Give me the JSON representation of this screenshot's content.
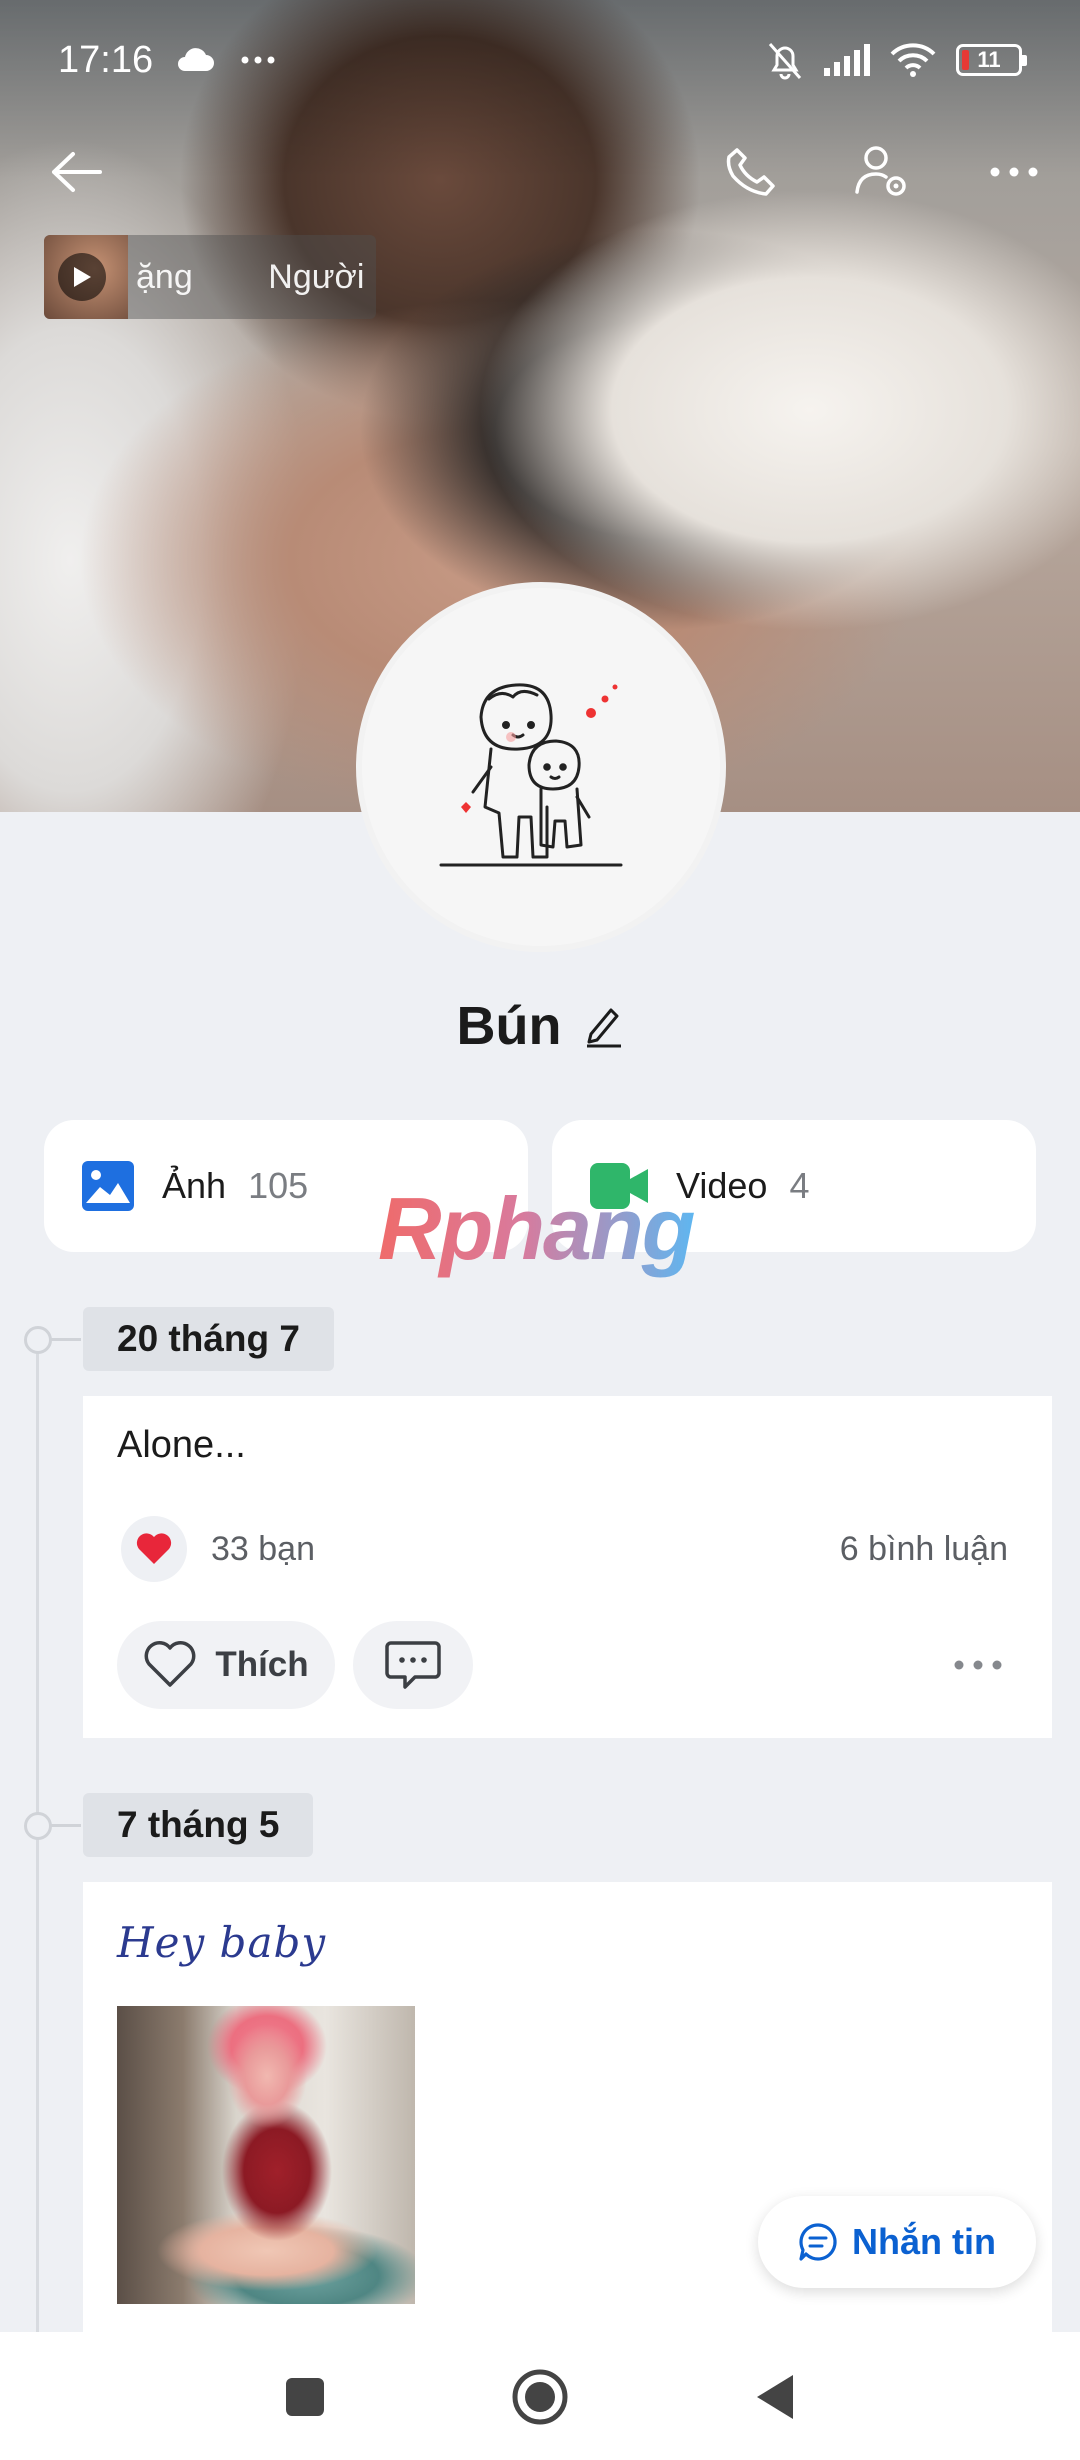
{
  "status_bar": {
    "time": "17:16",
    "battery_level": "11",
    "icons": [
      "cloud-icon",
      "more-dots-icon",
      "mute-bell-icon",
      "signal-icon",
      "wifi-icon",
      "battery-icon"
    ]
  },
  "top_nav": {
    "icons": [
      "back-arrow-icon",
      "phone-icon",
      "user-settings-icon",
      "more-icon"
    ]
  },
  "music": {
    "text": "ặng        Người"
  },
  "profile": {
    "name": "Bún"
  },
  "media": {
    "photos_label": "Ảnh",
    "photos_count": "105",
    "videos_label": "Video",
    "videos_count": "4"
  },
  "watermark": "Rphang",
  "posts": [
    {
      "date": "20 tháng 7",
      "text": "Alone...",
      "reactions": "33 bạn",
      "comments": "6 bình luận",
      "like_label": "Thích"
    },
    {
      "date": "7 tháng 5",
      "text": "Hey baby"
    }
  ],
  "fab": {
    "label": "Nhắn tin"
  },
  "colors": {
    "accent": "#0b61d1",
    "background": "#eef0f4",
    "photo_icon": "#1e6fe0",
    "video_icon": "#2fb66a",
    "heart": "#e8263a"
  }
}
